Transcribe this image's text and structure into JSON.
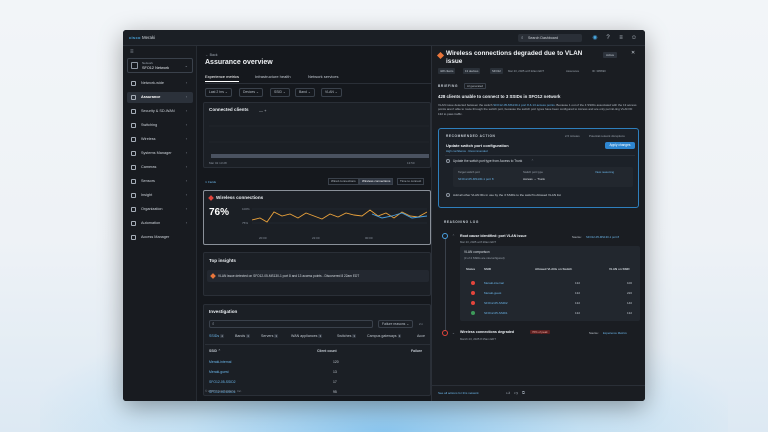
{
  "topbar": {
    "logo": "cisco",
    "app_name": "Meraki",
    "search_label": "Search Dashboard",
    "icons": [
      "notifications-icon",
      "help-icon",
      "menu-icon",
      "user-icon"
    ]
  },
  "sidebar": {
    "network_label": "Network",
    "network_name": "SFO12 Network",
    "items": [
      {
        "label": "Network-wide"
      },
      {
        "label": "Assurance"
      },
      {
        "label": "Security & SD-WAN"
      },
      {
        "label": "Switching"
      },
      {
        "label": "Wireless"
      },
      {
        "label": "Systems Manager"
      },
      {
        "label": "Cameras"
      },
      {
        "label": "Sensors"
      },
      {
        "label": "Insight"
      },
      {
        "label": "Organization"
      },
      {
        "label": "Automation"
      },
      {
        "label": "Access Manager"
      }
    ]
  },
  "main": {
    "back_label": "← Back",
    "title": "Assurance overview",
    "tabs": [
      "Experience metrics",
      "Infrastructure health",
      "Network services"
    ],
    "filters": [
      "Last 2 hrs ⌄",
      "Devices ⌄",
      "SSID ⌄",
      "Band ⌄",
      "VLAN ⌄"
    ],
    "connected_clients": {
      "title": "Connected clients",
      "extra": "—  +",
      "x_start": "Mar 02 13:28",
      "x_end": "13:50"
    },
    "fold_label": "∨ Fields",
    "segments": [
      "Wired connections",
      "Wireless connections",
      "Time to connect"
    ],
    "wireless": {
      "title": "Wireless connections",
      "value": "76%",
      "y_hi": "100%",
      "y_lo": "75%",
      "x_labels": [
        "20:00",
        "22:00",
        "00:00"
      ]
    },
    "insights": {
      "title": "Top insights",
      "text": "VLAN issue detected on SFO12-05-MS130-1 port 8 and 13 access points - Discovered 8 22am EDT"
    },
    "investigation": {
      "title": "Investigation",
      "search_placeholder": "",
      "filter_label": "Failure reasons ⌄",
      "extra": "2 n",
      "subtabs": [
        {
          "label": "SSIDs",
          "count": "4"
        },
        {
          "label": "Bands",
          "count": "3"
        },
        {
          "label": "Servers",
          "count": "3"
        },
        {
          "label": "WAN appliances",
          "count": "3"
        },
        {
          "label": "Switches",
          "count": "3"
        },
        {
          "label": "Campus gateways",
          "count": "3"
        },
        {
          "label": "Acce",
          "count": ""
        }
      ],
      "columns": [
        "SSID ⌃",
        "Client count",
        "Failure"
      ],
      "rows": [
        {
          "ssid": "Meraki-internal",
          "count": "120"
        },
        {
          "ssid": "Meraki-guest",
          "count": "13"
        },
        {
          "ssid": "SFO12-05-SSID2",
          "count": "17"
        },
        {
          "ssid": "SFO12-05-SSID1",
          "count": "95"
        }
      ]
    },
    "copyright": "© 2025 Cisco Systems, Inc."
  },
  "panel": {
    "title": "Wireless connections degraded due to VLAN issue",
    "status_badge": "Active",
    "close": "✕",
    "chips": [
      "428 clients",
      "13 devices",
      "SFO12"
    ],
    "meta": [
      "Mar 23, 2025 at 8:22am EDT",
      "Assurance",
      "ID: 395690"
    ],
    "briefing_label": "BRIEFING",
    "ai_badge": "AI generated",
    "summary_title": "428 clients unable to connect to 3 SSIDs in SFO12 network",
    "summary_text_1": "VLAN issue detected between the switch",
    "summary_link": "SFO12-05-MS130-1 port 8 & 13 access points",
    "summary_text_2": ". Because 1 out of the 4 SSIDs associated with the 13 access points aren't able to route through the switch port, because the switch port types have been configured to Access and are only permit-ting VLAN ID 132 to pass traffic.",
    "recommended": {
      "label": "RECOMMENDED ACTION",
      "time": "2-5 minutes",
      "disruption": "Potential network disruptions",
      "title": "Update switch port configuration",
      "confidence": "High confidence · Recommended",
      "apply_label": "Apply changes",
      "step1": "Update the switch port type from Access to Trunk",
      "target_label": "Target switch port",
      "target_value": "SFO12-05-MS130-1 port 8",
      "type_label": "Switch port type",
      "type_value": "Access → Trunk",
      "view_label": "View reasoning",
      "step2": "Add all other VLAN IDs in use by the 3 SSIDs to the switch's Allowed VLAN list"
    },
    "reasoning": {
      "label": "REASONING LOG",
      "step1_title": "Root cause identified: port VLAN issue",
      "step1_source_label": "Source:",
      "step1_source": "SFO12-05-MS130-1 port 8",
      "step1_time": "Mar 23, 2025 at 8:20am EDT",
      "table_title": "VLAN comparison",
      "table_sub": "(3 of 4 SSIDs are misconfigured)",
      "columns": [
        "Status",
        "SSID",
        "Allowed VLANs on Switch",
        "VLAN on SSID"
      ],
      "rows": [
        {
          "ssid": "Meraki-internal",
          "allowed": "132",
          "vlan": "100"
        },
        {
          "ssid": "Meraki-guest",
          "allowed": "132",
          "vlan": "220"
        },
        {
          "ssid": "SFO12-05-SSID2",
          "allowed": "132",
          "vlan": "140"
        },
        {
          "ssid": "SFO12-05-SSID1",
          "allowed": "132",
          "vlan": "132"
        }
      ],
      "step2_title": "Wireless connections degraded",
      "step2_badge": "76% of peak",
      "step2_source_label": "Source:",
      "step2_source": "Experience Metrics",
      "step2_time": "March 23, 2025 8:15am EDT"
    },
    "footer": "See all actions for this network"
  }
}
